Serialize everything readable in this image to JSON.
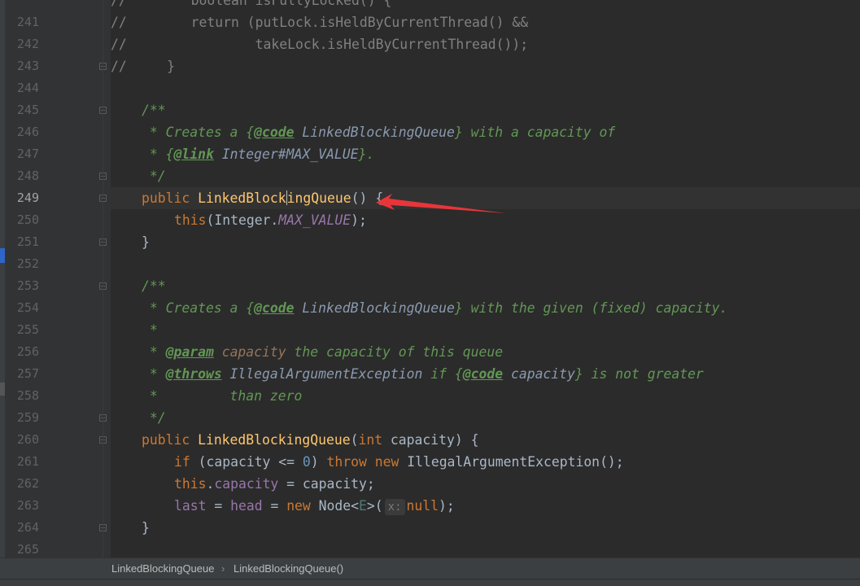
{
  "gutter": {
    "line_numbers": [
      "241",
      "242",
      "243",
      "244",
      "245",
      "246",
      "247",
      "248",
      "249",
      "250",
      "251",
      "252",
      "253",
      "254",
      "255",
      "256",
      "257",
      "258",
      "259",
      "260",
      "261",
      "262",
      "263",
      "264",
      "265"
    ],
    "current_line": "249"
  },
  "code": {
    "l240": "//        boolean isFullyLocked() {",
    "l241a": "//        return (putLock.isHeldByCurrentThread() &&",
    "l242a": "//                takeLock.isHeldByCurrentThread());",
    "l243a": "//     }",
    "l245": "/**",
    "l246a": " * Creates a ",
    "l246b": "{",
    "l246c": "@code",
    "l246d": " LinkedBlockingQueue",
    "l246e": "}",
    "l246f": " with a capacity of",
    "l247a": " * ",
    "l247b": "{",
    "l247c": "@link",
    "l247d": " Integer#MAX_VALUE",
    "l247e": "}",
    "l247f": ".",
    "l248": " */",
    "l249a": "public ",
    "l249b": "LinkedBlock",
    "l249c": "ingQueue",
    "l249d": "() {",
    "l250a": "this",
    "l250b": "(Integer.",
    "l250c": "MAX_VALUE",
    "l250d": ");",
    "l251": "}",
    "l253": "/**",
    "l254a": " * Creates a ",
    "l254b": "{",
    "l254c": "@code",
    "l254d": " LinkedBlockingQueue",
    "l254e": "}",
    "l254f": " with the given (fixed) capacity.",
    "l255": " *",
    "l256a": " * ",
    "l256b": "@param",
    "l256c": " capacity",
    "l256d": " the capacity of this queue",
    "l257a": " * ",
    "l257b": "@throws",
    "l257c": " IllegalArgumentException",
    "l257d": " if ",
    "l257e": "{",
    "l257f": "@code",
    "l257g": " capacity",
    "l257h": "}",
    "l257i": " is not greater",
    "l258": " *         than zero",
    "l259": " */",
    "l260a": "public ",
    "l260b": "LinkedBlockingQueue",
    "l260c": "(",
    "l260d": "int",
    "l260e": " capacity) {",
    "l261a": "if",
    "l261b": " (capacity <= ",
    "l261c": "0",
    "l261d": ") ",
    "l261e": "throw new ",
    "l261f": "IllegalArgumentException",
    "l261g": "();",
    "l262a": "this",
    "l262b": ".",
    "l262c": "capacity",
    "l262d": " = capacity;",
    "l263a": "last",
    "l263b": " = ",
    "l263c": "head",
    "l263d": " = ",
    "l263e": "new ",
    "l263f": "Node<",
    "l263g": "E",
    "l263h": ">(",
    "l263hint": "x:",
    "l263i": "null",
    "l263j": ");",
    "l264": "}"
  },
  "breadcrumb": {
    "class_name": "LinkedBlockingQueue",
    "separator": "›",
    "method_name": "LinkedBlockingQueue()"
  },
  "colors": {
    "background": "#2b2b2b",
    "keyword": "#cc7832",
    "method": "#ffc66d",
    "field": "#9876aa",
    "doc_comment": "#629755",
    "arrow": "#e8353a"
  }
}
